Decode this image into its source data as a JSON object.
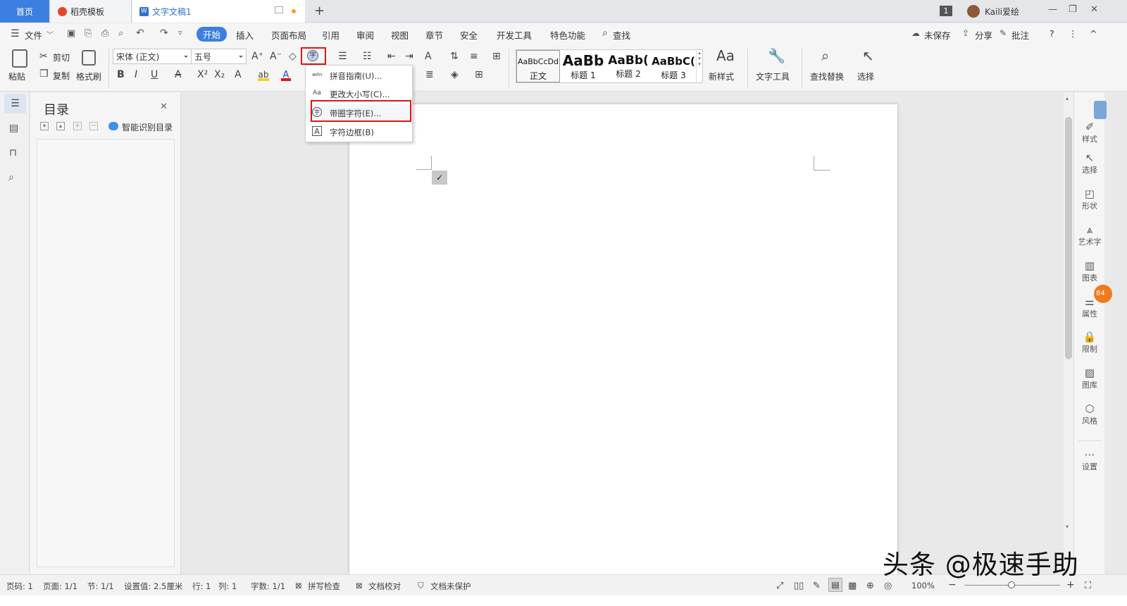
{
  "tabs": {
    "home": "首页",
    "template": "稻壳模板",
    "doc": "文字文稿1",
    "add": "+"
  },
  "window": {
    "badge": "1",
    "user": "Kaili爱绘",
    "minimize": "—",
    "restore": "❐",
    "close": "✕"
  },
  "menu": {
    "file": "文件",
    "items": [
      "开始",
      "插入",
      "页面布局",
      "引用",
      "审阅",
      "视图",
      "章节",
      "安全",
      "开发工具",
      "特色功能",
      "查找"
    ],
    "right": {
      "save": "未保存",
      "share": "分享",
      "comment": "批注",
      "help": "?",
      "more": "⋮",
      "collapse": "^"
    }
  },
  "ribbon": {
    "paste": "粘贴",
    "cut": "剪切",
    "copy": "复制",
    "format_painter": "格式刷",
    "font_name": "宋体 (正文)",
    "font_size": "五号",
    "styles": [
      {
        "preview": "AaBbCcDd",
        "label": "正文"
      },
      {
        "preview": "AaBb",
        "label": "标题 1"
      },
      {
        "preview": "AaBb(",
        "label": "标题 2"
      },
      {
        "preview": "AaBbC(",
        "label": "标题 3"
      }
    ],
    "new_style": "新样式",
    "text_tools": "文字工具",
    "find_replace": "查找替换",
    "select": "选择"
  },
  "dropdown": {
    "items": [
      {
        "icon": "wén",
        "label": "拼音指南(U)..."
      },
      {
        "icon": "Aa",
        "label": "更改大小写(C)..."
      },
      {
        "icon": "字",
        "label": "带圈字符(E)..."
      },
      {
        "icon": "A",
        "label": "字符边框(B)"
      }
    ]
  },
  "toc": {
    "title": "目录",
    "smart": "智能识别目录",
    "close": "✕"
  },
  "right_panel": [
    "样式",
    "选择",
    "形状",
    "艺术字",
    "图表",
    "属性",
    "限制",
    "图库",
    "风格",
    "设置"
  ],
  "badge_number": "84",
  "status": {
    "page": "页码: 1",
    "pages": "页面: 1/1",
    "section": "节: 1/1",
    "setting": "设置值: 2.5厘米",
    "row": "行: 1",
    "col": "列: 1",
    "words": "字数: 1/1",
    "spell": "拼写检查",
    "proof": "文档校对",
    "protect": "文档未保护",
    "zoom": "100%"
  },
  "watermark": "头条 @极速手助",
  "colors": {
    "accent": "#3d7fe0",
    "highlight_red": "#e01515",
    "tab_text": "#2f6fd0"
  }
}
